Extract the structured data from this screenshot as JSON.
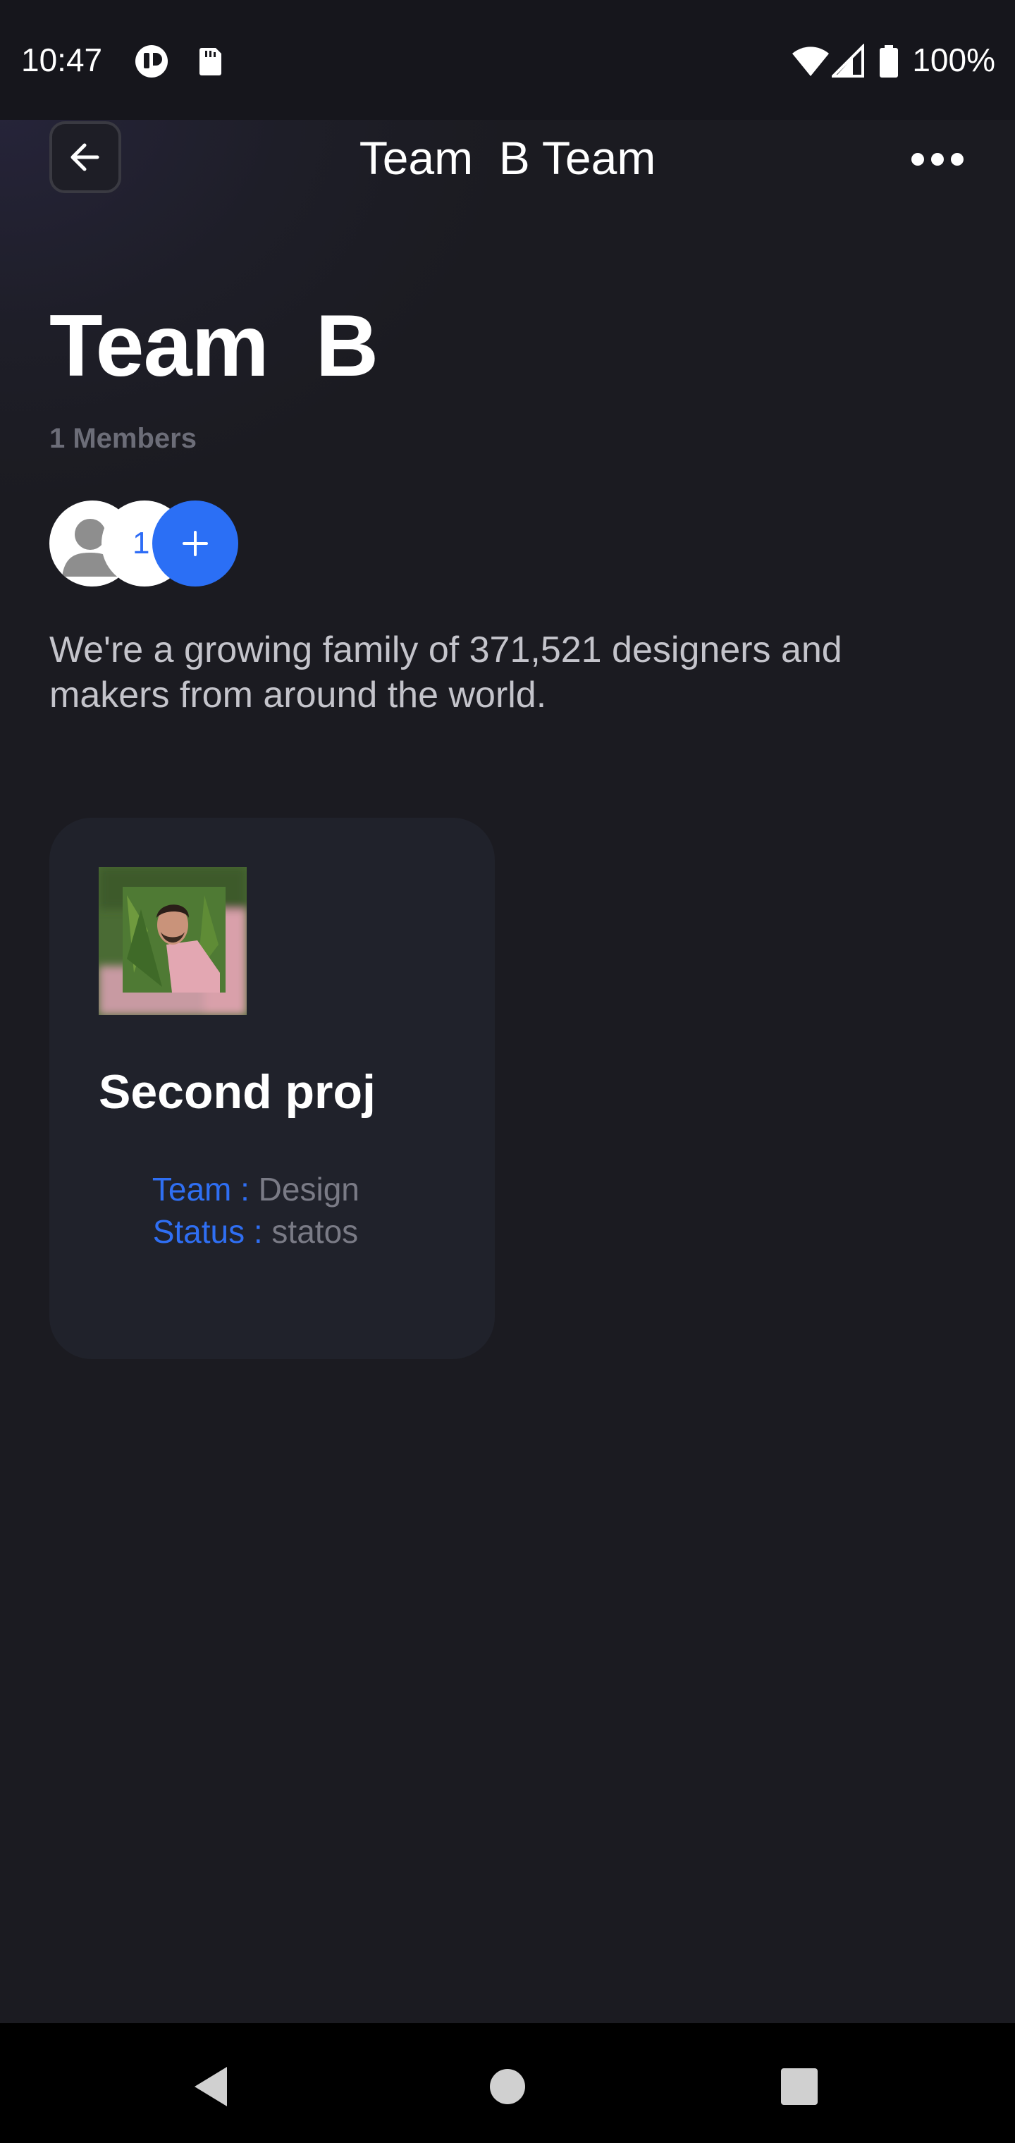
{
  "status_bar": {
    "time": "10:47",
    "battery": "100%",
    "icons": [
      "notification-app-icon",
      "sd-card-icon",
      "wifi-icon",
      "signal-icon",
      "battery-icon"
    ]
  },
  "header": {
    "title": "Team  B Team",
    "back_icon": "arrow-left-icon",
    "more_icon": "more-horizontal-icon"
  },
  "team": {
    "name": "Team  B",
    "members_label": "1 Members",
    "member_count_badge": "1",
    "description": "We're a growing family of 371,521 designers and makers from around the world."
  },
  "projects": [
    {
      "title": "Second proj",
      "team_label": "Team :",
      "team_value": " Design",
      "status_label": "Status :",
      "status_value": " statos"
    }
  ],
  "colors": {
    "accent": "#2b6ff5",
    "background": "#1b1b21",
    "card": "#20222b",
    "muted_text": "#6c6d78"
  },
  "nav": {
    "items": [
      "back-triangle-icon",
      "home-circle-icon",
      "recents-square-icon"
    ]
  }
}
